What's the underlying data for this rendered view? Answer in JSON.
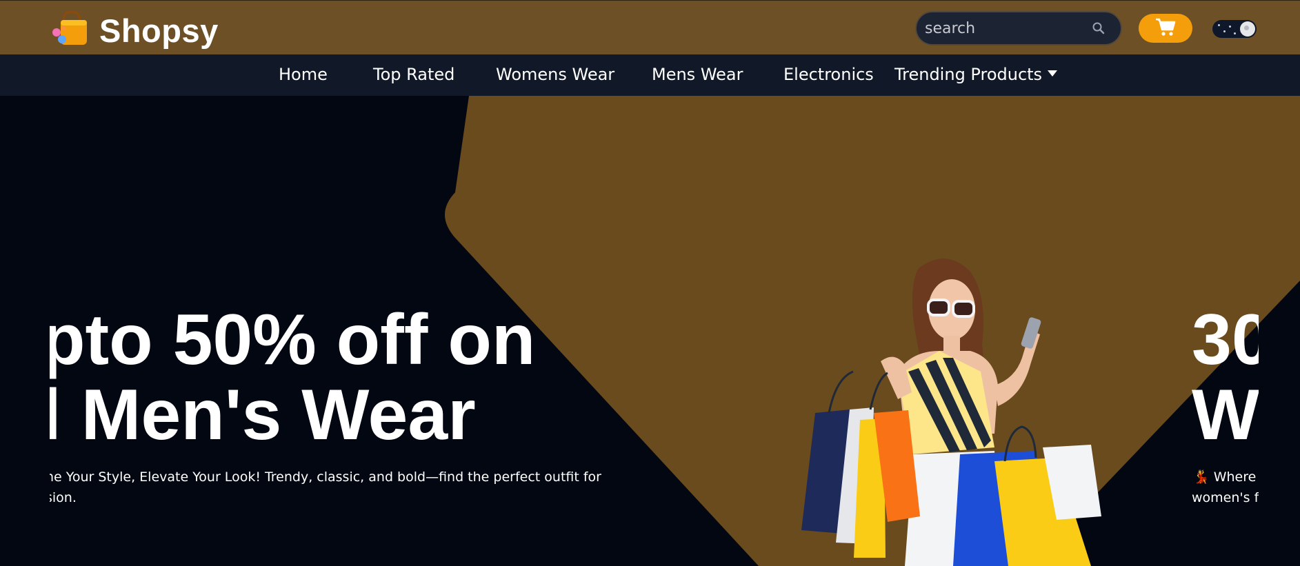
{
  "header": {
    "brand": "Shopsy",
    "search_placeholder": "search",
    "colors": {
      "topbar": "#6e5027",
      "accent": "#f59e0b",
      "nav": "#111827"
    }
  },
  "icons": {
    "logo": "shopping-bag-icon",
    "search": "search-icon",
    "cart": "cart-icon",
    "theme": "moon-toggle-icon",
    "dropdown": "caret-down-icon"
  },
  "nav": {
    "items": [
      {
        "label": "Home"
      },
      {
        "label": "Top Rated"
      },
      {
        "label": "Womens Wear"
      },
      {
        "label": "Mens Wear"
      },
      {
        "label": "Electronics"
      },
      {
        "label": "Trending Products"
      }
    ]
  },
  "hero": {
    "slides": [
      {
        "line1": "pto 50% off on",
        "line2": "l Men's Wear",
        "sub1": "ne Your Style, Elevate Your Look! Trendy, classic, and bold—find the perfect outfit for",
        "sub2": "sion."
      },
      {
        "line1": "30",
        "line2": "W",
        "sub1": "💃 Where",
        "sub2": "women's f"
      }
    ]
  }
}
